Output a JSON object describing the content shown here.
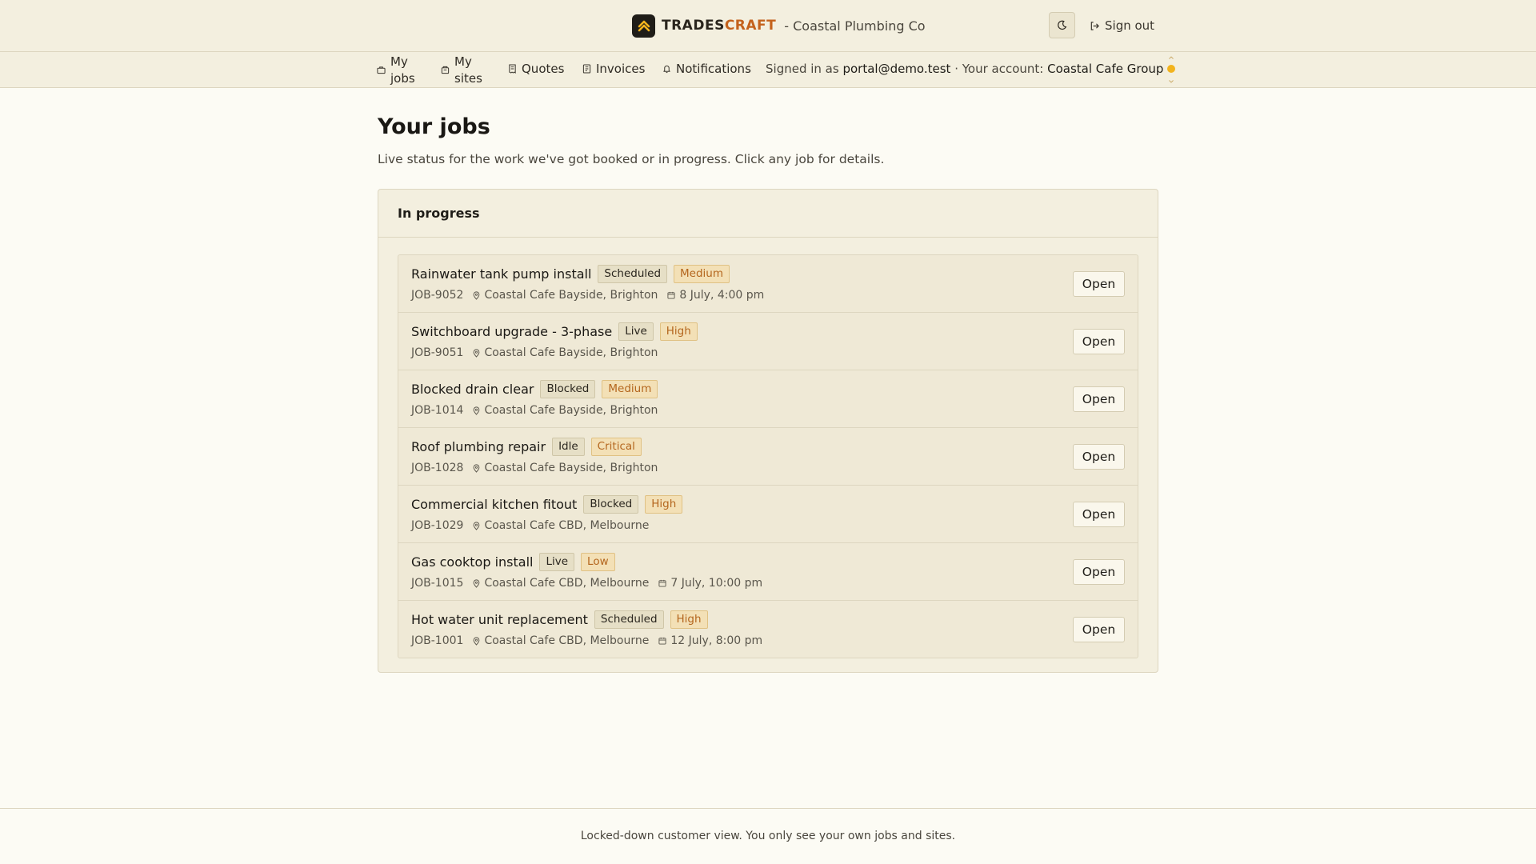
{
  "header": {
    "brand_part1": "TRADES",
    "brand_part2": "CRAFT",
    "brand_sub": "- Coastal Plumbing Co",
    "theme_icon": "moon-icon",
    "signout_label": "Sign out",
    "signout_icon": "sign-out-icon"
  },
  "nav": {
    "items": [
      {
        "label": "My jobs",
        "icon": "briefcase-icon"
      },
      {
        "label": "My sites",
        "icon": "building-icon"
      },
      {
        "label": "Quotes",
        "icon": "receipt-icon"
      },
      {
        "label": "Invoices",
        "icon": "invoice-icon"
      },
      {
        "label": "Notifications",
        "icon": "bell-icon"
      }
    ],
    "signed_in_prefix": "Signed in as",
    "signed_in_email": "portal@demo.test",
    "account_prefix": "· Your account:",
    "account_name": "Coastal Cafe Group"
  },
  "main": {
    "title": "Your jobs",
    "description": "Live status for the work we've got booked or in progress. Click any job for details.",
    "section_title": "In progress",
    "open_label": "Open",
    "jobs": [
      {
        "title": "Rainwater tank pump install",
        "status": "Scheduled",
        "priority": "Medium",
        "id": "JOB-9052",
        "site": "Coastal Cafe Bayside, Brighton",
        "date": "8 July, 4:00 pm"
      },
      {
        "title": "Switchboard upgrade - 3-phase",
        "status": "Live",
        "priority": "High",
        "id": "JOB-9051",
        "site": "Coastal Cafe Bayside, Brighton",
        "date": ""
      },
      {
        "title": "Blocked drain clear",
        "status": "Blocked",
        "priority": "Medium",
        "id": "JOB-1014",
        "site": "Coastal Cafe Bayside, Brighton",
        "date": ""
      },
      {
        "title": "Roof plumbing repair",
        "status": "Idle",
        "priority": "Critical",
        "id": "JOB-1028",
        "site": "Coastal Cafe Bayside, Brighton",
        "date": ""
      },
      {
        "title": "Commercial kitchen fitout",
        "status": "Blocked",
        "priority": "High",
        "id": "JOB-1029",
        "site": "Coastal Cafe CBD, Melbourne",
        "date": ""
      },
      {
        "title": "Gas cooktop install",
        "status": "Live",
        "priority": "Low",
        "id": "JOB-1015",
        "site": "Coastal Cafe CBD, Melbourne",
        "date": "7 July, 10:00 pm"
      },
      {
        "title": "Hot water unit replacement",
        "status": "Scheduled",
        "priority": "High",
        "id": "JOB-1001",
        "site": "Coastal Cafe CBD, Melbourne",
        "date": "12 July, 8:00 pm"
      }
    ]
  },
  "footer": {
    "text": "Locked-down customer view. You only see your own jobs and sites."
  },
  "colors": {
    "accent": "#c4621c",
    "status_dot": "#f2b31d",
    "background": "#fcfbf4",
    "panel": "#f3efdf"
  }
}
